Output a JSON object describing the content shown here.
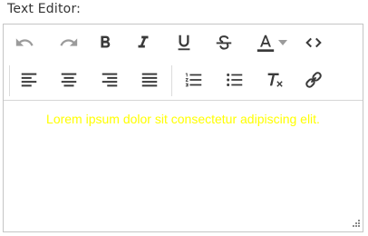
{
  "label": "Text Editor:",
  "content": {
    "text": "Lorem ipsum dolor sit consectetur adipiscing elit.",
    "text_color": "#ffff00"
  },
  "toolbar": {
    "row1": [
      {
        "name": "undo-button",
        "icon": "undo-icon",
        "enabled": false
      },
      {
        "name": "redo-button",
        "icon": "redo-icon",
        "enabled": false
      },
      {
        "name": "bold-button",
        "icon": "bold-icon",
        "enabled": true
      },
      {
        "name": "italic-button",
        "icon": "italic-icon",
        "enabled": true
      },
      {
        "name": "underline-button",
        "icon": "underline-icon",
        "enabled": true
      },
      {
        "name": "strikethrough-button",
        "icon": "strikethrough-icon",
        "enabled": true
      },
      {
        "name": "font-color-button",
        "icon": "font-color-icon",
        "enabled": true
      },
      {
        "name": "source-code-button",
        "icon": "code-icon",
        "enabled": true
      }
    ],
    "row2": [
      {
        "name": "align-left-button",
        "icon": "align-left-icon",
        "enabled": true
      },
      {
        "name": "align-center-button",
        "icon": "align-center-icon",
        "enabled": true
      },
      {
        "name": "align-right-button",
        "icon": "align-right-icon",
        "enabled": true
      },
      {
        "name": "justify-button",
        "icon": "justify-icon",
        "enabled": true
      },
      {
        "name": "ordered-list-button",
        "icon": "ordered-list-icon",
        "enabled": true
      },
      {
        "name": "bullet-list-button",
        "icon": "bullet-list-icon",
        "enabled": true
      },
      {
        "name": "clear-format-button",
        "icon": "clear-format-icon",
        "enabled": true
      },
      {
        "name": "insert-link-button",
        "icon": "link-icon",
        "enabled": true
      }
    ]
  },
  "colors": {
    "icon": "#3a3a3a",
    "icon_disabled": "#9b9b9b",
    "border": "#c5c5c5"
  }
}
